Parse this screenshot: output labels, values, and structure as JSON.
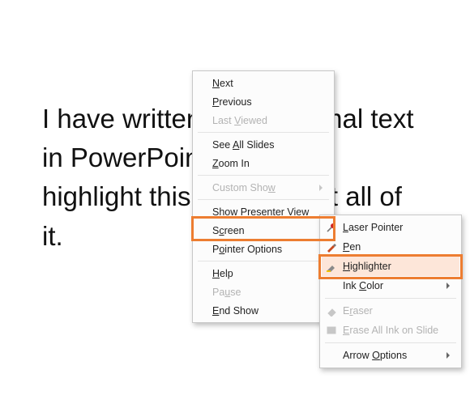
{
  "slide_text": "I have written some normal text in PowerPoint. I want to highlight this text, but not all of it.",
  "menu": {
    "next": {
      "pre": "",
      "u": "N",
      "post": "ext"
    },
    "previous": {
      "pre": "",
      "u": "P",
      "post": "revious"
    },
    "last_viewed": {
      "pre": "Last ",
      "u": "V",
      "post": "iewed"
    },
    "see_all": {
      "pre": "See ",
      "u": "A",
      "post": "ll Slides"
    },
    "zoom": {
      "pre": "",
      "u": "Z",
      "post": "oom In"
    },
    "custom_show": {
      "pre": "Custom Sho",
      "u": "w",
      "post": ""
    },
    "presenter_view": {
      "pre": "Show Presenter Vie",
      "u": "w",
      "post": ""
    },
    "screen": {
      "pre": "S",
      "u": "c",
      "post": "reen"
    },
    "pointer": {
      "pre": "P",
      "u": "o",
      "post": "inter Options"
    },
    "help": {
      "pre": "",
      "u": "H",
      "post": "elp"
    },
    "pause": {
      "pre": "Pa",
      "u": "u",
      "post": "se"
    },
    "end": {
      "pre": "",
      "u": "E",
      "post": "nd Show"
    }
  },
  "submenu": {
    "laser": {
      "pre": "",
      "u": "L",
      "post": "aser Pointer"
    },
    "pen": {
      "pre": "",
      "u": "P",
      "post": "en"
    },
    "highlighter": {
      "pre": "",
      "u": "H",
      "post": "ighlighter"
    },
    "ink_color": {
      "pre": "Ink ",
      "u": "C",
      "post": "olor"
    },
    "eraser": {
      "pre": "E",
      "u": "r",
      "post": "aser"
    },
    "erase_all": {
      "pre": "",
      "u": "E",
      "post": "rase All Ink on Slide"
    },
    "arrow": {
      "pre": "Arrow ",
      "u": "O",
      "post": "ptions"
    }
  }
}
